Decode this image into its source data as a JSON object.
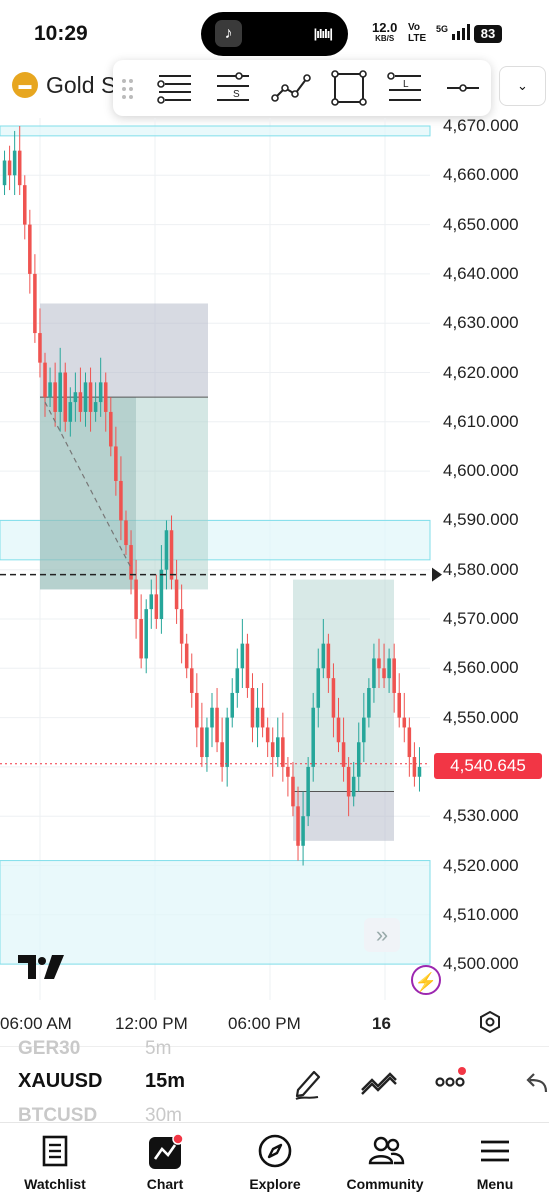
{
  "status_bar": {
    "time": "10:29",
    "net_speed": "12.0",
    "net_speed_unit": "KB/S",
    "volte_top": "Vo",
    "volte_bottom": "LTE",
    "network": "5G",
    "battery": "83"
  },
  "symbol_header": {
    "title": "Gold S"
  },
  "toolbar": {
    "tools": [
      "horizontal-lines-tool",
      "support-level-tool",
      "trend-line-tool",
      "rectangle-tool",
      "level-tool",
      "horizontal-ray-tool"
    ],
    "labels": {
      "support": "S",
      "level": "L"
    }
  },
  "chart": {
    "price_ticks": [
      "4,670.000",
      "4,660.000",
      "4,650.000",
      "4,640.000",
      "4,630.000",
      "4,620.000",
      "4,610.000",
      "4,600.000",
      "4,590.000",
      "4,580.000",
      "4,570.000",
      "4,560.000",
      "4,550.000",
      "4,540.000",
      "4,530.000",
      "4,520.000",
      "4,510.000",
      "4,500.000"
    ],
    "last_price": "4,540.645",
    "time_ticks": [
      "06:00 AM",
      "12:00 PM",
      "06:00 PM",
      "16"
    ],
    "colors": {
      "up": "#26a69a",
      "down": "#ef5350",
      "zone": "#80deea",
      "last_price": "#f23645"
    }
  },
  "chart_data": {
    "type": "candlestick",
    "symbol": "XAUUSD",
    "interval": "15m",
    "ylim": [
      4495,
      4675
    ],
    "last_price": 4540.645,
    "horizontal_line": 4579,
    "zones": [
      [
        4668,
        4670
      ],
      [
        4582,
        4590
      ],
      [
        4500,
        4521
      ]
    ],
    "candles_close_approx": [
      4663,
      4660,
      4665,
      4658,
      4650,
      4640,
      4628,
      4622,
      4615,
      4618,
      4612,
      4620,
      4610,
      4614,
      4616,
      4612,
      4618,
      4612,
      4614,
      4618,
      4612,
      4605,
      4598,
      4590,
      4585,
      4578,
      4570,
      4562,
      4572,
      4575,
      4570,
      4580,
      4588,
      4578,
      4572,
      4565,
      4560,
      4555,
      4548,
      4542,
      4548,
      4552,
      4545,
      4540,
      4550,
      4555,
      4560,
      4565,
      4556,
      4548,
      4552,
      4548,
      4545,
      4542,
      4546,
      4540,
      4538,
      4532,
      4524,
      4530,
      4540,
      4552,
      4560,
      4565,
      4558,
      4550,
      4545,
      4540,
      4534,
      4538,
      4545,
      4550,
      4556,
      4562,
      4560,
      4558,
      4562,
      4555,
      4550,
      4548,
      4542,
      4538,
      4540
    ]
  },
  "lower_strip": {
    "ghost_top_symbol": "GER30",
    "ghost_top_interval": "5m",
    "symbol": "XAUUSD",
    "interval": "15m",
    "ghost_bottom_symbol": "BTCUSD",
    "ghost_bottom_interval": "30m"
  },
  "bottom_nav": {
    "items": [
      {
        "label": "Watchlist",
        "icon": "list-icon"
      },
      {
        "label": "Chart",
        "icon": "chart-icon"
      },
      {
        "label": "Explore",
        "icon": "compass-icon"
      },
      {
        "label": "Community",
        "icon": "people-icon"
      },
      {
        "label": "Menu",
        "icon": "hamburger-icon"
      }
    ]
  }
}
